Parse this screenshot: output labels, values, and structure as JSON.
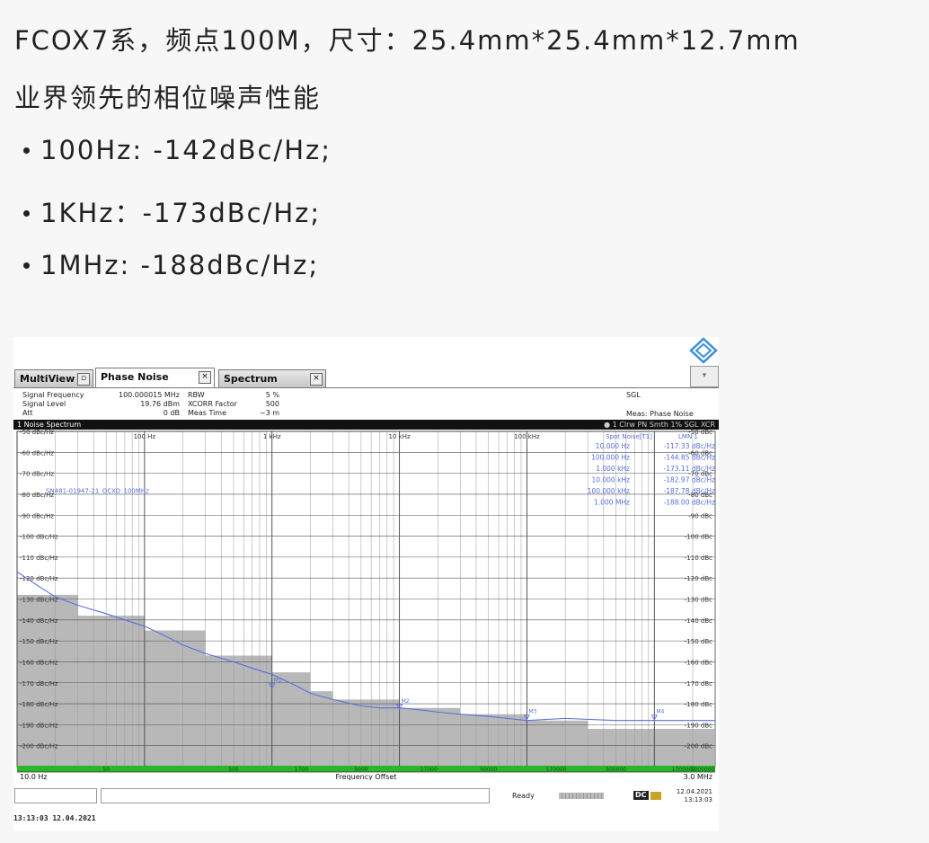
{
  "heading": {
    "line1": "FCOX7系，频点100M，尺寸：25.4mm*25.4mm*12.7mm",
    "line2": "业界领先的相位噪声性能"
  },
  "specs": [
    "100Hz: -142dBc/Hz;",
    "1KHz：-173dBc/Hz;",
    "1MHz: -188dBc/Hz;"
  ],
  "analyzer": {
    "logo_icon": "rohde-schwarz-logo-icon",
    "tabs": [
      "MultiView",
      "Phase Noise",
      "Spectrum"
    ],
    "active_tab": "Phase Noise",
    "info": {
      "signal_frequency_label": "Signal Frequency",
      "signal_frequency_value": "100.000015 MHz",
      "signal_level_label": "Signal Level",
      "signal_level_value": "19.76 dBm",
      "att_label": "Att",
      "att_value": "0 dB",
      "rbw_label": "RBW",
      "rbw_value": "5 %",
      "xcorr_label": "XCORR Factor",
      "xcorr_value": "500",
      "meas_time_label": "Meas Time",
      "meas_time_value": "~3 m",
      "sgl": "SGL",
      "mode": "Meas: Phase Noise"
    },
    "window_title": "1 Noise Spectrum",
    "window_right": "● 1 Clrw PN Smth 1% SGL XCR",
    "marker_header": "Spot Noise[T1]",
    "marker_header_right": "LMN 1",
    "spot_noise": [
      {
        "freq": "10.000 Hz",
        "val": "-117.33 dBc/Hz"
      },
      {
        "freq": "100.000 Hz",
        "val": "-144.85 dBc/Hz"
      },
      {
        "freq": "1.000 kHz",
        "val": "-173.11 dBc/Hz"
      },
      {
        "freq": "10.000 kHz",
        "val": "-182.97 dBc/Hz"
      },
      {
        "freq": "100.000 kHz",
        "val": "-187.78 dBc/Hz"
      },
      {
        "freq": "1.000 MHz",
        "val": "-188.00 dBc/Hz"
      }
    ],
    "trace_label": "SN481-01947-21_OCXO_100MHz",
    "x_start": "10.0 Hz",
    "x_stop": "3.0 MHz",
    "x_axis_label": "Frequency Offset",
    "status_ready": "Ready",
    "status_dc": "DC",
    "status_date": "12.04.2021",
    "status_time": "13:13:03",
    "footer_timestamp": "13:13:03  12.04.2021",
    "colors": {
      "trace": "#5a6fe0",
      "limit_fill": "#b8b8b8",
      "green": "#2bb52b",
      "grid": "#666666"
    }
  },
  "chart_data": {
    "type": "line",
    "title": "1 Noise Spectrum",
    "xlabel": "Frequency Offset",
    "ylabel": "",
    "xscale": "log",
    "xlim_hz": [
      10,
      3000000
    ],
    "ylim": [
      -210,
      -50
    ],
    "x_tick_labels": [
      "100 Hz",
      "1 kHz",
      "10 kHz",
      "100 kHz"
    ],
    "x_tick_values_hz": [
      100,
      1000,
      10000,
      100000
    ],
    "y_tick_values": [
      -50,
      -60,
      -70,
      -80,
      -90,
      -100,
      -110,
      -120,
      -130,
      -140,
      -150,
      -160,
      -170,
      -180,
      -190,
      -200
    ],
    "y_tick_labels_left": [
      "-50 dBc/Hz",
      "-60 dBc/Hz",
      "-70 dBc/Hz",
      "-80 dBc/Hz",
      "-90 dBc/Hz",
      "-100 dBc/Hz",
      "-110 dBc/Hz",
      "-120 dBc/Hz",
      "-130 dBc/Hz",
      "-140 dBc/Hz",
      "-150 dBc/Hz",
      "-160 dBc/Hz",
      "-170 dBc/Hz",
      "-180 dBc/Hz",
      "-190 dBc/Hz",
      "-200 dBc/Hz"
    ],
    "y_tick_labels_right": [
      "-50 dBc",
      "-60 dBc",
      "-70 dBc",
      "-80 dBc",
      "-90 dBc",
      "-100 dBc",
      "-110 dBc",
      "-120 dBc",
      "-130 dBc",
      "-140 dBc",
      "-150 dBc",
      "-160 dBc",
      "-170 dBc",
      "-180 dBc",
      "-190 dBc",
      "-200 dBc"
    ],
    "green_bar_labels": [
      "50",
      "500",
      "1700",
      "5000",
      "17000",
      "50000",
      "170000",
      "500000",
      "1700000",
      "5000000"
    ],
    "series": [
      {
        "name": "SN481-01947-21_OCXO_100MHz",
        "x_hz": [
          10,
          14,
          20,
          30,
          50,
          70,
          100,
          150,
          200,
          300,
          500,
          700,
          1000,
          1500,
          2000,
          3000,
          5000,
          7000,
          10000,
          15000,
          20000,
          30000,
          50000,
          70000,
          100000,
          200000,
          500000,
          1000000,
          3000000
        ],
        "y": [
          -117,
          -123,
          -129,
          -133,
          -137,
          -140,
          -143,
          -148,
          -152,
          -156,
          -160,
          -163,
          -166,
          -171,
          -175,
          -178,
          -181,
          -182,
          -182,
          -183,
          -184,
          -185,
          -186,
          -187,
          -188,
          -187,
          -188,
          -188,
          -188
        ]
      }
    ],
    "noise_floor_fill": {
      "x_hz": [
        10,
        30,
        100,
        300,
        1000,
        2000,
        3000,
        10000,
        30000,
        100000,
        300000,
        3000000
      ],
      "y": [
        -128,
        -138,
        -145,
        -157,
        -165,
        -174,
        -178,
        -182,
        -185,
        -188,
        -192,
        -195
      ]
    },
    "markers": [
      {
        "label": "M1",
        "x_hz": 1000,
        "y": -173
      },
      {
        "label": "M2",
        "x_hz": 10000,
        "y": -183
      },
      {
        "label": "M3",
        "x_hz": 100000,
        "y": -188
      },
      {
        "label": "M4",
        "x_hz": 1000000,
        "y": -188
      }
    ]
  }
}
